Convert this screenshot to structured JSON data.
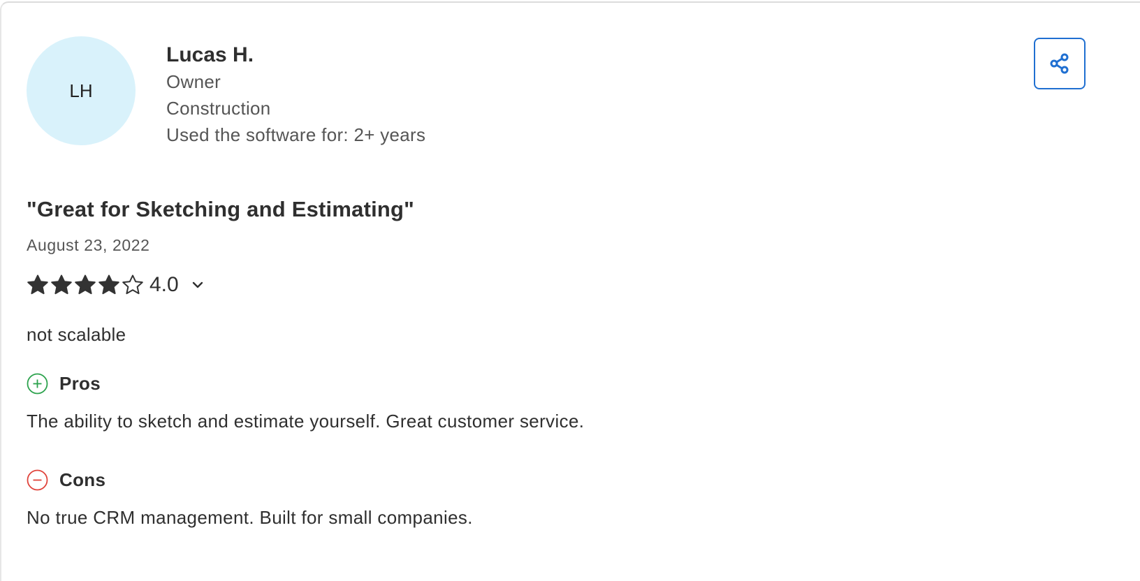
{
  "reviewer": {
    "initials": "LH",
    "name": "Lucas H.",
    "role": "Owner",
    "industry": "Construction",
    "usage": "Used the software for: 2+ years"
  },
  "share": {
    "icon": "share-icon",
    "color": "#1f6fd1"
  },
  "review": {
    "title": "\"Great for Sketching and Estimating\"",
    "date": "August 23, 2022",
    "rating": {
      "value": 4,
      "max": 5,
      "label": "4.0"
    },
    "summary": "not scalable",
    "pros": {
      "label": "Pros",
      "text": "The ability to sketch and estimate yourself. Great customer service.",
      "icon": "plus-circle-icon",
      "color": "#2ba24c"
    },
    "cons": {
      "label": "Cons",
      "text": "No true CRM management. Built for small companies.",
      "icon": "minus-circle-icon",
      "color": "#e0433b"
    }
  },
  "colors": {
    "avatar_bg": "#d9f2fb",
    "star": "#333333"
  }
}
